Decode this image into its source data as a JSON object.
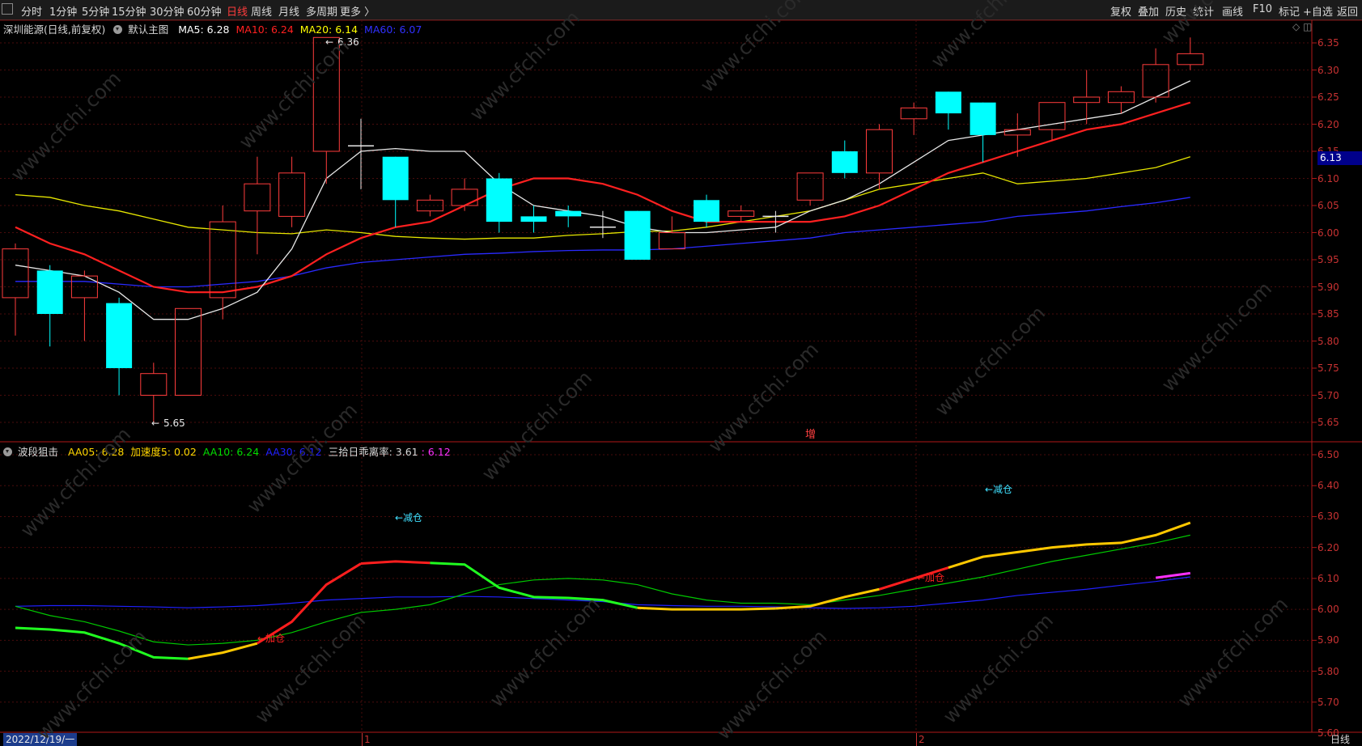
{
  "toolbar": {
    "periods": [
      "分时",
      "1分钟",
      "5分钟",
      "15分钟",
      "30分钟",
      "60分钟",
      "日线",
      "周线",
      "月线",
      "多周期",
      "更多 〉"
    ],
    "active_period": "日线",
    "right_buttons": [
      "复权",
      "叠加",
      "历史",
      "统计",
      "画线",
      "F10",
      "标记",
      "+自选",
      "返回"
    ]
  },
  "main": {
    "stock": "深圳能源(日线,前复权)",
    "subchart_name": "默认主图",
    "ma": [
      {
        "label": "MA5: 6.28",
        "color": "#ffffff"
      },
      {
        "label": "MA10: 6.24",
        "color": "#ff2020"
      },
      {
        "label": "MA20: 6.14",
        "color": "#ffff00"
      },
      {
        "label": "MA60: 6.07",
        "color": "#3030ff"
      }
    ],
    "high_label": "6.36",
    "low_label": "5.65",
    "last_price": "6.13",
    "mark": "增",
    "axis_ticks": [
      "6.35",
      "6.30",
      "6.25",
      "6.20",
      "6.15",
      "6.10",
      "6.05",
      "6.00",
      "5.95",
      "5.90",
      "5.85",
      "5.80",
      "5.75",
      "5.70",
      "5.65"
    ]
  },
  "indicator": {
    "name": "波段狙击",
    "items": [
      {
        "label": "AA05: 6.28",
        "color": "#ffd700"
      },
      {
        "label": "加速度5: 0.02",
        "color": "#ffd700"
      },
      {
        "label": "AA10: 6.24",
        "color": "#00dd00"
      },
      {
        "label": "AA30: 6.12",
        "color": "#2020ff"
      },
      {
        "label": "三拾日乖离率: 3.61",
        "color": "#d8d8d8"
      },
      {
        "label": ": 6.12",
        "color": "#ff30ff"
      }
    ],
    "annotations": [
      {
        "text": "←减仓",
        "color": "#40e0ff"
      },
      {
        "text": "←减仓",
        "color": "#40e0ff"
      },
      {
        "text": "←加仓",
        "color": "#ff2020"
      },
      {
        "text": "←加仓",
        "color": "#ff2020"
      }
    ],
    "axis_ticks": [
      "6.50",
      "6.40",
      "6.30",
      "6.20",
      "6.10",
      "6.00",
      "5.90",
      "5.80",
      "5.70",
      "5.60"
    ]
  },
  "bottom": {
    "date": "2022/12/19/一",
    "month1": "1",
    "month2": "2",
    "period": "日线"
  },
  "watermark": "www.cfchi.com",
  "chart_data": {
    "type": "candlestick",
    "candles": [
      {
        "o": 5.88,
        "c": 5.97,
        "h": 5.98,
        "l": 5.81
      },
      {
        "o": 5.93,
        "c": 5.85,
        "h": 5.94,
        "l": 5.79
      },
      {
        "o": 5.88,
        "c": 5.92,
        "h": 5.93,
        "l": 5.8
      },
      {
        "o": 5.87,
        "c": 5.75,
        "h": 5.88,
        "l": 5.7
      },
      {
        "o": 5.7,
        "c": 5.74,
        "h": 5.76,
        "l": 5.65
      },
      {
        "o": 5.7,
        "c": 5.86,
        "h": 5.86,
        "l": 5.7
      },
      {
        "o": 5.88,
        "c": 6.02,
        "h": 6.05,
        "l": 5.84
      },
      {
        "o": 6.04,
        "c": 6.09,
        "h": 6.14,
        "l": 5.96
      },
      {
        "o": 6.03,
        "c": 6.11,
        "h": 6.14,
        "l": 6.01
      },
      {
        "o": 6.15,
        "c": 6.36,
        "h": 6.36,
        "l": 6.09
      },
      {
        "o": 6.16,
        "c": 6.16,
        "h": 6.21,
        "l": 6.08
      },
      {
        "o": 6.14,
        "c": 6.06,
        "h": 6.14,
        "l": 6.01
      },
      {
        "o": 6.04,
        "c": 6.06,
        "h": 6.07,
        "l": 6.03
      },
      {
        "o": 6.05,
        "c": 6.08,
        "h": 6.1,
        "l": 6.04
      },
      {
        "o": 6.1,
        "c": 6.02,
        "h": 6.11,
        "l": 6.0
      },
      {
        "o": 6.03,
        "c": 6.02,
        "h": 6.05,
        "l": 6.0
      },
      {
        "o": 6.04,
        "c": 6.03,
        "h": 6.05,
        "l": 6.01
      },
      {
        "o": 6.01,
        "c": 6.01,
        "h": 6.04,
        "l": 5.99
      },
      {
        "o": 6.04,
        "c": 5.95,
        "h": 6.04,
        "l": 5.95
      },
      {
        "o": 5.97,
        "c": 6.0,
        "h": 6.03,
        "l": 5.97
      },
      {
        "o": 6.06,
        "c": 6.02,
        "h": 6.07,
        "l": 6.01
      },
      {
        "o": 6.03,
        "c": 6.04,
        "h": 6.05,
        "l": 6.02
      },
      {
        "o": 6.03,
        "c": 6.03,
        "h": 6.04,
        "l": 6.0
      },
      {
        "o": 6.06,
        "c": 6.11,
        "h": 6.11,
        "l": 6.05
      },
      {
        "o": 6.15,
        "c": 6.11,
        "h": 6.17,
        "l": 6.1
      },
      {
        "o": 6.11,
        "c": 6.19,
        "h": 6.2,
        "l": 6.08
      },
      {
        "o": 6.21,
        "c": 6.23,
        "h": 6.24,
        "l": 6.18
      },
      {
        "o": 6.26,
        "c": 6.22,
        "h": 6.26,
        "l": 6.19
      },
      {
        "o": 6.24,
        "c": 6.18,
        "h": 6.24,
        "l": 6.13
      },
      {
        "o": 6.18,
        "c": 6.19,
        "h": 6.22,
        "l": 6.14
      },
      {
        "o": 6.19,
        "c": 6.24,
        "h": 6.24,
        "l": 6.17
      },
      {
        "o": 6.24,
        "c": 6.25,
        "h": 6.3,
        "l": 6.2
      },
      {
        "o": 6.24,
        "c": 6.26,
        "h": 6.27,
        "l": 6.22
      },
      {
        "o": 6.25,
        "c": 6.31,
        "h": 6.34,
        "l": 6.24
      },
      {
        "o": 6.31,
        "c": 6.33,
        "h": 6.36,
        "l": 6.3
      }
    ],
    "ma5": [
      5.94,
      5.93,
      5.92,
      5.89,
      5.84,
      5.84,
      5.86,
      5.89,
      5.97,
      6.1,
      6.15,
      6.155,
      6.15,
      6.15,
      6.09,
      6.05,
      6.04,
      6.03,
      6.01,
      6.0,
      6.0,
      6.005,
      6.01,
      6.04,
      6.06,
      6.09,
      6.13,
      6.17,
      6.18,
      6.19,
      6.2,
      6.21,
      6.22,
      6.25,
      6.28
    ],
    "ma10": [
      6.01,
      5.98,
      5.96,
      5.93,
      5.9,
      5.89,
      5.89,
      5.9,
      5.92,
      5.96,
      5.99,
      6.01,
      6.02,
      6.05,
      6.08,
      6.1,
      6.1,
      6.09,
      6.07,
      6.04,
      6.02,
      6.02,
      6.02,
      6.02,
      6.03,
      6.05,
      6.08,
      6.11,
      6.13,
      6.15,
      6.17,
      6.19,
      6.2,
      6.22,
      6.24
    ],
    "ma20": [
      6.07,
      6.065,
      6.05,
      6.04,
      6.025,
      6.01,
      6.005,
      6.0,
      5.998,
      6.005,
      6.0,
      5.993,
      5.99,
      5.988,
      5.99,
      5.99,
      5.995,
      5.998,
      6.002,
      6.003,
      6.01,
      6.02,
      6.03,
      6.04,
      6.06,
      6.08,
      6.09,
      6.1,
      6.11,
      6.09,
      6.095,
      6.1,
      6.11,
      6.12,
      6.14
    ],
    "ma60": [
      5.91,
      5.91,
      5.91,
      5.905,
      5.9,
      5.9,
      5.905,
      5.91,
      5.92,
      5.935,
      5.945,
      5.95,
      5.955,
      5.96,
      5.962,
      5.965,
      5.967,
      5.968,
      5.968,
      5.97,
      5.975,
      5.98,
      5.985,
      5.99,
      6.0,
      6.005,
      6.01,
      6.015,
      6.02,
      6.03,
      6.035,
      6.04,
      6.048,
      6.055,
      6.065
    ]
  }
}
